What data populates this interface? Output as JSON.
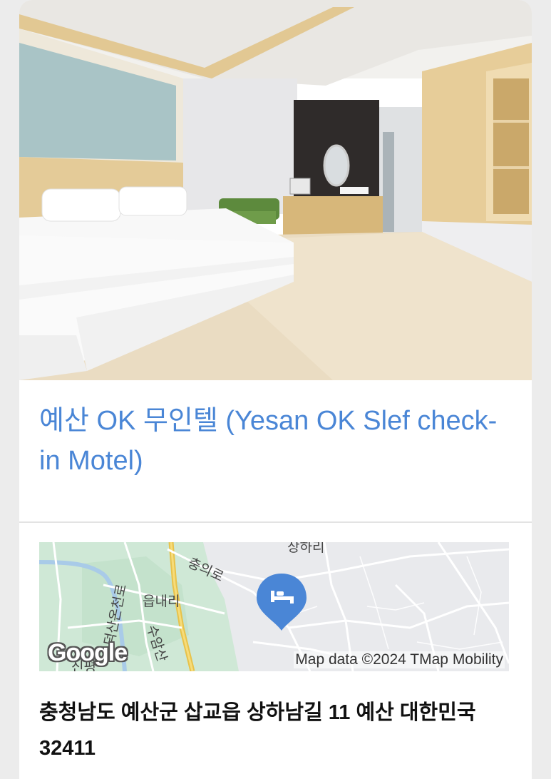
{
  "listing": {
    "title": "예산 OK 무인텔 (Yesan OK Slef check-in Motel)",
    "address": "충청남도 예산군 삽교읍 상하남길 11 예산 대한민국 32411"
  },
  "map": {
    "attribution": "Map data ©2024 TMap Mobility",
    "logo_text": "Google",
    "labels": {
      "top": "상하리",
      "road": "충의로",
      "district": "읍내리",
      "vertical_left": "덕산온천로",
      "vertical_right": "수암산",
      "bottom_left": "신평"
    },
    "marker_icon": "hotel-bed-icon",
    "marker_color": "#4a86d6"
  },
  "colors": {
    "title": "#4a86d6",
    "address": "#111111"
  }
}
